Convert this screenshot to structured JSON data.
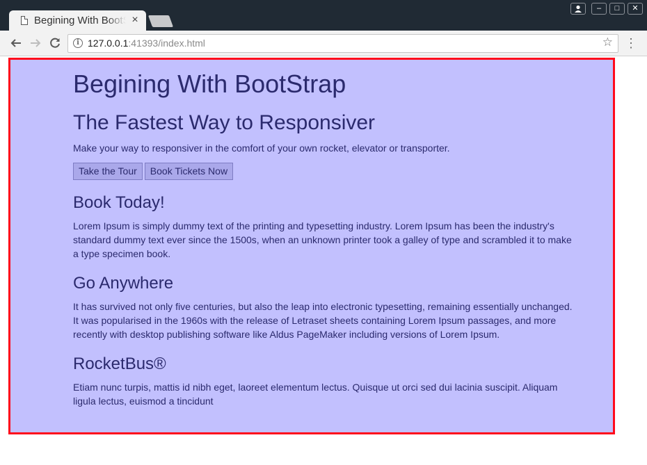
{
  "browser": {
    "tab_title": "Begining With BootStrap",
    "tab_close": "×",
    "url_host": "127.0.0.1",
    "url_rest": ":41393/index.html",
    "window_controls": {
      "minimize": "–",
      "maximize": "□",
      "close": "✕"
    }
  },
  "page": {
    "title": "Begining With BootStrap",
    "hero_heading": "The Fastest Way to Responsiver",
    "hero_text": "Make your way to responsiver in the comfort of your own rocket, elevator or transporter.",
    "buttons": {
      "tour": "Take the Tour",
      "tickets": "Book Tickets Now"
    },
    "sections": [
      {
        "heading": "Book Today!",
        "text": "Lorem Ipsum is simply dummy text of the printing and typesetting industry. Lorem Ipsum has been the industry's standard dummy text ever since the 1500s, when an unknown printer took a galley of type and scrambled it to make a type specimen book."
      },
      {
        "heading": "Go Anywhere",
        "text": "It has survived not only five centuries, but also the leap into electronic typesetting, remaining essentially unchanged. It was popularised in the 1960s with the release of Letraset sheets containing Lorem Ipsum passages, and more recently with desktop publishing software like Aldus PageMaker including versions of Lorem Ipsum."
      },
      {
        "heading": "RocketBus®",
        "text": "Etiam nunc turpis, mattis id nibh eget, laoreet elementum lectus. Quisque ut orci sed dui lacinia suscipit. Aliquam ligula lectus, euismod a tincidunt"
      }
    ]
  },
  "colors": {
    "page_background": "#c2c0fe",
    "frame_border": "#ff0a1c",
    "text": "#2b2a6d",
    "titlebar": "#202a34"
  }
}
